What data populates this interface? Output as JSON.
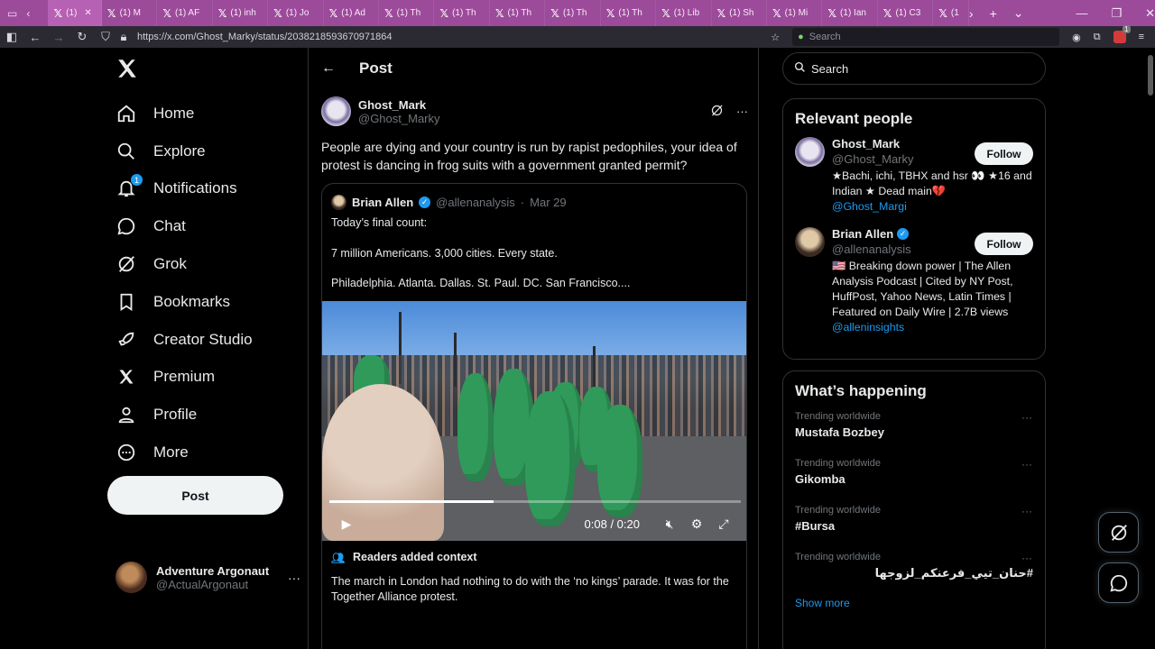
{
  "browser": {
    "tabs": [
      {
        "label": "(1)"
      },
      {
        "label": "(1) M"
      },
      {
        "label": "(1) AF"
      },
      {
        "label": "(1) inh"
      },
      {
        "label": "(1) Jo"
      },
      {
        "label": "(1) Ad"
      },
      {
        "label": "(1) Th"
      },
      {
        "label": "(1) Th"
      },
      {
        "label": "(1) Th"
      },
      {
        "label": "(1) Th"
      },
      {
        "label": "(1) Th"
      },
      {
        "label": "(1) Lib"
      },
      {
        "label": "(1) Sh"
      },
      {
        "label": "(1) Mi"
      },
      {
        "label": "(1) Ian"
      },
      {
        "label": "(1) C3"
      },
      {
        "label": "(1"
      }
    ],
    "url": "https://x.com/Ghost_Marky/status/2038218593670971864",
    "search_placeholder": "Search",
    "extension_count": "1"
  },
  "sidebar": {
    "items": [
      {
        "label": "Home"
      },
      {
        "label": "Explore"
      },
      {
        "label": "Notifications",
        "badge": "1"
      },
      {
        "label": "Chat"
      },
      {
        "label": "Grok"
      },
      {
        "label": "Bookmarks"
      },
      {
        "label": "Creator Studio"
      },
      {
        "label": "Premium"
      },
      {
        "label": "Profile"
      },
      {
        "label": "More"
      }
    ],
    "post_button": "Post",
    "account": {
      "name": "Adventure Argonaut",
      "handle": "@ActualArgonaut"
    }
  },
  "main": {
    "title": "Post",
    "author": {
      "name": "Ghost_Mark",
      "handle": "@Ghost_Marky"
    },
    "text": "People are dying and your country is run by rapist pedophiles, your idea of protest is dancing in frog suits with a government granted permit?",
    "quote": {
      "name": "Brian Allen",
      "handle": "@allenanalysis",
      "date": "Mar 29",
      "lines": [
        "Today’s final count:",
        "7 million Americans. 3,000 cities. Every state.",
        "Philadelphia. Atlanta. Dallas. St. Paul. DC. San Francisco...."
      ],
      "video": {
        "time": "0:08 / 0:20",
        "progress": 0.4
      },
      "readers_title": "Readers added context",
      "readers_text": "The march in London had nothing to do with the ‘no kings’ parade. It was for the Together Alliance protest."
    }
  },
  "right": {
    "search_placeholder": "Search",
    "relevant_title": "Relevant people",
    "people": [
      {
        "name": "Ghost_Mark",
        "handle": "@Ghost_Marky",
        "bio": "★Bachi, ichi, TBHX and hsr 👀 ★16 and Indian ★ Dead main💔",
        "link": "@Ghost_Margi",
        "follow": "Follow"
      },
      {
        "name": "Brian Allen",
        "handle": "@allenanalysis",
        "bio": "🇺🇸 Breaking down power | The Allen Analysis Podcast | Cited by NY Post, HuffPost, Yahoo News, Latin Times | Featured on Daily Wire | 2.7B views",
        "link": "@alleninsights",
        "follow": "Follow"
      }
    ],
    "happening_title": "What’s happening",
    "trends": [
      {
        "meta": "Trending worldwide",
        "name": "Mustafa Bozbey"
      },
      {
        "meta": "Trending worldwide",
        "name": "Gikomba"
      },
      {
        "meta": "Trending worldwide",
        "name": "#Bursa"
      },
      {
        "meta": "Trending worldwide",
        "name": "#حنان_تيي_فرعنكم_لزوجها"
      }
    ],
    "show_more": "Show more"
  }
}
